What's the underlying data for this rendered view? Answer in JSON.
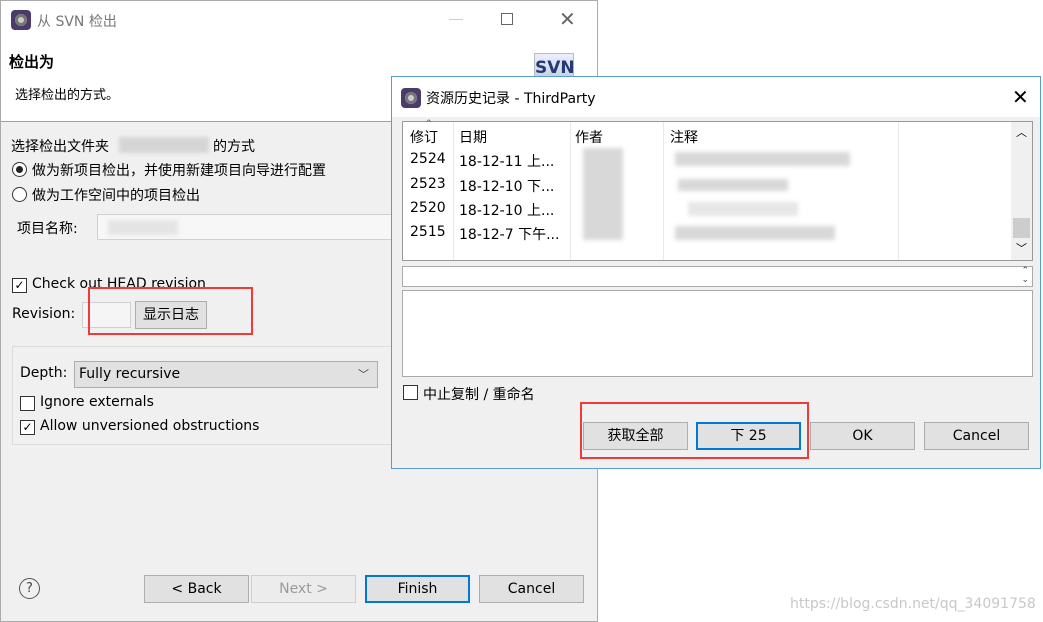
{
  "checkout_dialog": {
    "title": "从 SVN 检出",
    "header_title": "检出为",
    "header_desc": "选择检出的方式。",
    "logo_text": "SVN",
    "folder_label_prefix": "选择检出文件夹",
    "folder_label_suffix": "的方式",
    "radio_new_project": "做为新项目检出，并使用新建项目向导进行配置",
    "radio_workspace": "做为工作空间中的项目检出",
    "project_name_label": "项目名称:",
    "head_revision_label": "Check out HEAD revision",
    "head_revision_checked": true,
    "revision_label": "Revision:",
    "revision_value": "",
    "show_log_button": "显示日志",
    "depth_label": "Depth:",
    "depth_value": "Fully recursive",
    "ignore_externals_label": "Ignore externals",
    "ignore_externals_checked": false,
    "allow_unversioned_label": "Allow unversioned obstructions",
    "allow_unversioned_checked": true,
    "buttons": {
      "back": "< Back",
      "next": "Next >",
      "finish": "Finish",
      "cancel": "Cancel"
    }
  },
  "history_dialog": {
    "title": "资源历史记录 - ThirdParty",
    "columns": [
      "修订",
      "日期",
      "作者",
      "注释"
    ],
    "rows": [
      {
        "revision": "2524",
        "date": "18-12-11 上..."
      },
      {
        "revision": "2523",
        "date": "18-12-10 下..."
      },
      {
        "revision": "2520",
        "date": "18-12-10 上..."
      },
      {
        "revision": "2515",
        "date": "18-12-7 下午..."
      }
    ],
    "stop_copy_label": "中止复制 / 重命名",
    "stop_copy_checked": false,
    "buttons": {
      "get_all": "获取全部",
      "next_25": "下 25",
      "ok": "OK",
      "cancel": "Cancel"
    }
  },
  "watermark": "https://blog.csdn.net/qq_34091758",
  "colors": {
    "highlight": "#f03a3a",
    "focus": "#0078d7"
  }
}
